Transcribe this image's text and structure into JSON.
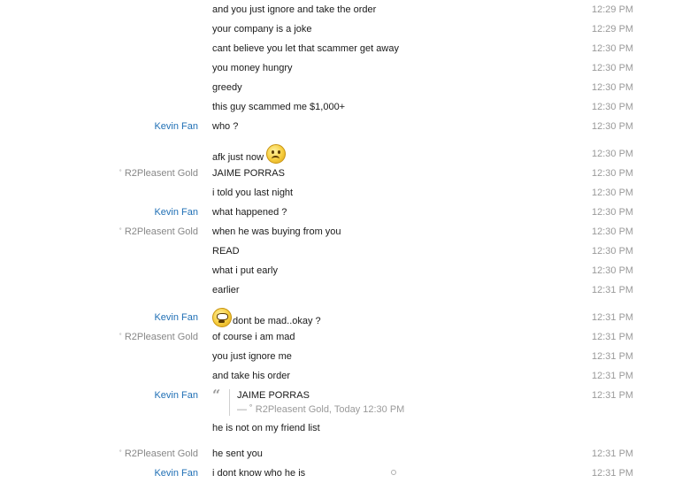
{
  "messages": [
    {
      "sender": "",
      "text": "and you just ignore and take the order",
      "time": "12:29 PM"
    },
    {
      "sender": "",
      "text": "your company is a joke",
      "time": "12:29 PM"
    },
    {
      "sender": "",
      "text": "cant believe you let that scammer get away",
      "time": "12:30 PM"
    },
    {
      "sender": "",
      "text": "you money hungry",
      "time": "12:30 PM"
    },
    {
      "sender": "",
      "text": "greedy",
      "time": "12:30 PM"
    },
    {
      "sender": "",
      "text": "this guy scammed me $1,000+",
      "time": "12:30 PM"
    },
    {
      "sender": "Kevin Fan",
      "text": "who ?",
      "time": "12:30 PM"
    },
    {
      "sender": "",
      "text": "afk just now",
      "time": "12:30 PM",
      "emoji": "sad-face-icon"
    },
    {
      "sender": "R2Pleasent Gold",
      "text": "JAIME PORRAS",
      "time": "12:30 PM"
    },
    {
      "sender": "",
      "text": "i told you last night",
      "time": "12:30 PM"
    },
    {
      "sender": "Kevin Fan",
      "text": "what happened ?",
      "time": "12:30 PM"
    },
    {
      "sender": "R2Pleasent Gold",
      "text": "when he was buying from you",
      "time": "12:30 PM"
    },
    {
      "sender": "",
      "text": "READ",
      "time": "12:30 PM"
    },
    {
      "sender": "",
      "text": "what i put early",
      "time": "12:30 PM"
    },
    {
      "sender": "",
      "text": "earlier",
      "time": "12:31 PM"
    },
    {
      "sender": "Kevin Fan",
      "text": "dont be mad..okay ?",
      "time": "12:31 PM",
      "emoji": "worried-face-icon"
    },
    {
      "sender": "R2Pleasent Gold",
      "text": "of course i am mad",
      "time": "12:31 PM"
    },
    {
      "sender": "",
      "text": "you just ignore me",
      "time": "12:31 PM"
    },
    {
      "sender": "",
      "text": "and take his order",
      "time": "12:31 PM"
    }
  ],
  "quote_message": {
    "sender": "Kevin Fan",
    "time": "12:31 PM",
    "quoted_text": "JAIME PORRAS",
    "quoted_meta": "— ˚ R2Pleasent Gold, Today 12:30 PM",
    "text": "he is not on my friend list"
  },
  "tail_messages": [
    {
      "sender": "R2Pleasent Gold",
      "text": "he sent you",
      "time": "12:31 PM"
    },
    {
      "sender": "Kevin Fan",
      "text": "i dont know who he is",
      "time": "12:31 PM"
    }
  ],
  "sender_marker": "˚",
  "colors": {
    "kevin": "#1f6fb5",
    "other_sender": "#888888",
    "timestamp": "#9a9a9a"
  }
}
